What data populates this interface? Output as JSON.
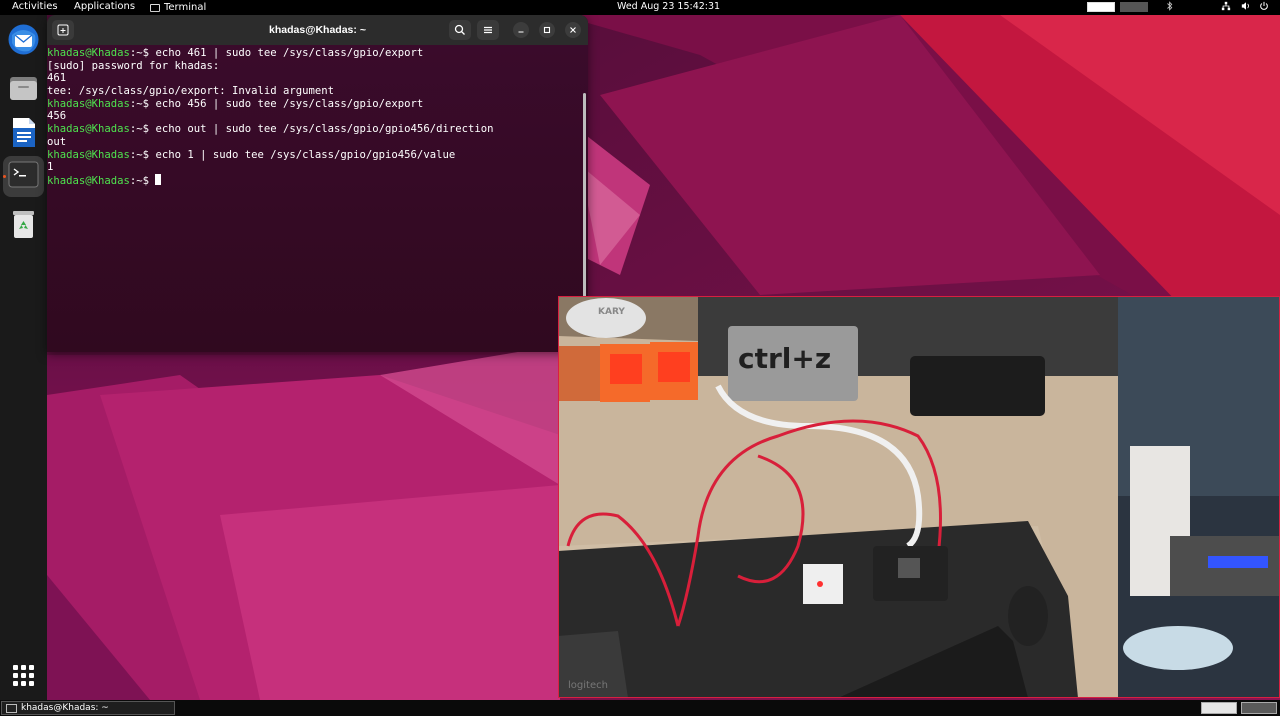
{
  "topbar": {
    "activities": "Activities",
    "applications": "Applications",
    "app_name": "Terminal",
    "clock": "Wed Aug 23  15:42:31"
  },
  "dock": {
    "items": [
      {
        "icon": "thunderbird-icon"
      },
      {
        "icon": "files-icon"
      },
      {
        "icon": "writer-icon"
      },
      {
        "icon": "terminal-icon",
        "active": true
      },
      {
        "icon": "trash-icon"
      },
      {
        "icon": "show-apps-icon"
      }
    ]
  },
  "terminal": {
    "title": "khadas@Khadas: ~",
    "prompt_user": "khadas@Khadas",
    "prompt_path": ":~$",
    "lines": [
      {
        "type": "cmd",
        "text": " echo 461 | sudo tee /sys/class/gpio/export"
      },
      {
        "type": "out",
        "text": "[sudo] password for khadas:"
      },
      {
        "type": "out",
        "text": "461"
      },
      {
        "type": "out",
        "text": "tee: /sys/class/gpio/export: Invalid argument"
      },
      {
        "type": "cmd",
        "text": " echo 456 | sudo tee /sys/class/gpio/export"
      },
      {
        "type": "out",
        "text": "456"
      },
      {
        "type": "cmd",
        "text": " echo out | sudo tee /sys/class/gpio/gpio456/direction"
      },
      {
        "type": "out",
        "text": "out"
      },
      {
        "type": "cmd",
        "text": " echo 1 | sudo tee /sys/class/gpio/gpio456/value"
      },
      {
        "type": "out",
        "text": "1"
      },
      {
        "type": "cmd",
        "text": " "
      }
    ]
  },
  "camera": {
    "keyboard_label": "ctrl+z",
    "mouse_brand": "KARY",
    "pad_brand": "logitech"
  },
  "taskbar": {
    "task_label": "khadas@Khadas: ~"
  },
  "colors": {
    "prompt_green": "#4ee24e",
    "terminal_bg": "#300a24",
    "accent": "#e95420"
  }
}
